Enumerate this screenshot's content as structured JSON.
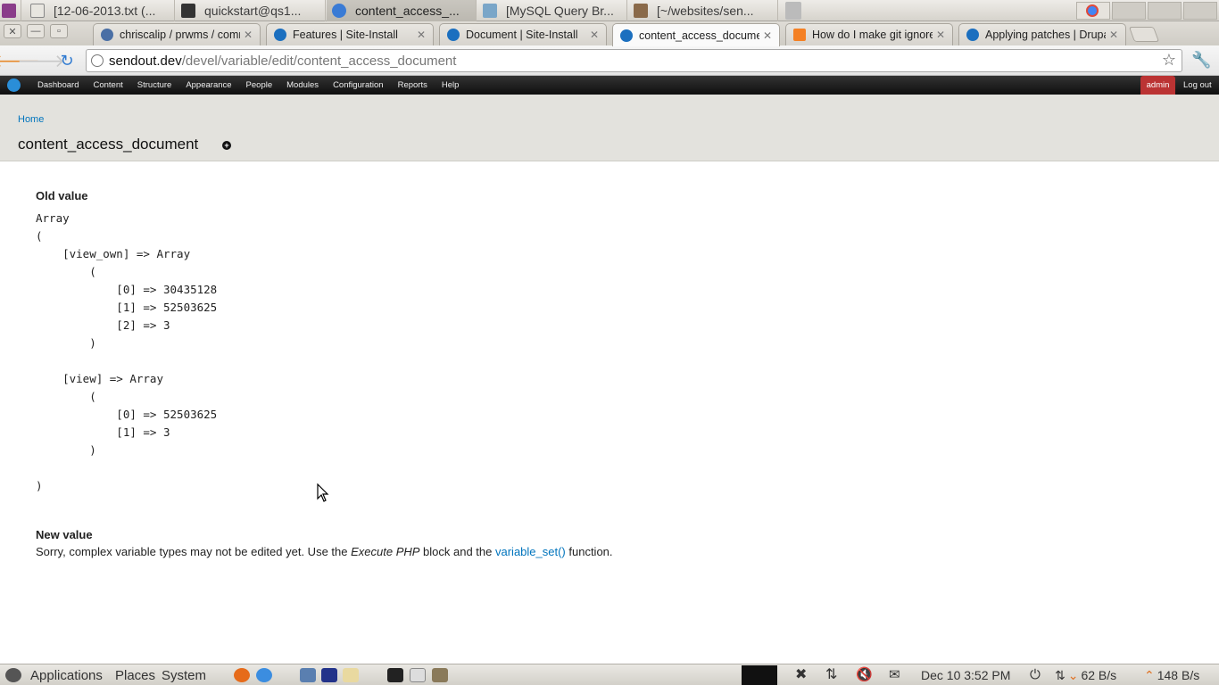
{
  "top_panel": {
    "tasks": [
      {
        "label": "[12-06-2013.txt (..."
      },
      {
        "label": "quickstart@qs1..."
      },
      {
        "label": "content_access_..."
      },
      {
        "label": "[MySQL Query Br..."
      },
      {
        "label": "[~/websites/sen..."
      }
    ]
  },
  "browser": {
    "tabs": [
      {
        "title": "chriscalip / prwms / comm"
      },
      {
        "title": "Features | Site-Install"
      },
      {
        "title": "Document | Site-Install"
      },
      {
        "title": "content_access_documen"
      },
      {
        "title": "How do I make git ignore r"
      },
      {
        "title": "Applying patches | Drupal"
      }
    ],
    "url_host": "sendout.dev",
    "url_path": "/devel/variable/edit/content_access_document"
  },
  "admin_toolbar": {
    "items": [
      "Dashboard",
      "Content",
      "Structure",
      "Appearance",
      "People",
      "Modules",
      "Configuration",
      "Reports",
      "Help"
    ],
    "user": "admin",
    "logout": "Log out"
  },
  "page": {
    "breadcrumb": "Home",
    "title": "content_access_document",
    "old_value_label": "Old value",
    "old_value": "Array\n(\n    [view_own] => Array\n        (\n            [0] => 30435128\n            [1] => 52503625\n            [2] => 3\n        )\n\n    [view] => Array\n        (\n            [0] => 52503625\n            [1] => 3\n        )\n\n)",
    "new_value_label": "New value",
    "new_value_text_1": "Sorry, complex variable types may not be edited yet. Use the ",
    "new_value_em": "Execute PHP",
    "new_value_text_2": " block and the ",
    "new_value_link": "variable_set()",
    "new_value_text_3": " function."
  },
  "bottom_panel": {
    "applications": "Applications",
    "places": "Places",
    "system": "System",
    "datetime": "Dec 10  3:52 PM",
    "net_down": "62 B/s",
    "net_up": "148 B/s"
  },
  "colors": {
    "link": "#0074bd",
    "admin_bar": "#1a1a1a",
    "user_tab": "#b33333",
    "page_head_bg": "#e3e2dd"
  }
}
